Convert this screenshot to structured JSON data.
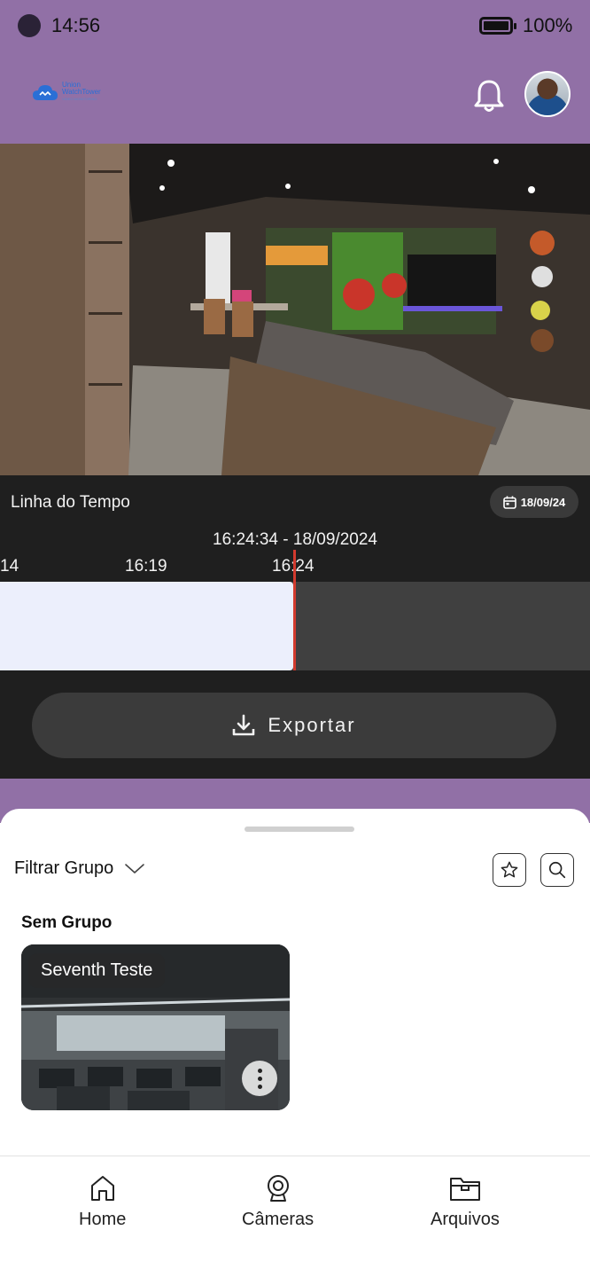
{
  "status_bar": {
    "time": "14:56",
    "battery": "100%"
  },
  "header": {
    "logo_line1": "Union",
    "logo_line2": "WatchTower",
    "logo_line3": "VIDEO MONITORING"
  },
  "timeline": {
    "title": "Linha do Tempo",
    "date_chip": "18/09/24",
    "current": "16:24:34 - 18/09/2024",
    "ticks": [
      "14",
      "16:19",
      "16:24"
    ],
    "recorded_fraction": 0.497,
    "export_label": "Exportar"
  },
  "sheet": {
    "filter_label": "Filtrar Grupo",
    "group_title": "Sem Grupo",
    "camera_name": "Seventh Teste"
  },
  "nav": {
    "home": "Home",
    "cameras": "Câmeras",
    "files": "Arquivos"
  },
  "colors": {
    "header_bg": "#9170a6",
    "panel_bg": "#1f1f1f",
    "playhead": "#d23a2e",
    "recorded": "#eceffc"
  }
}
